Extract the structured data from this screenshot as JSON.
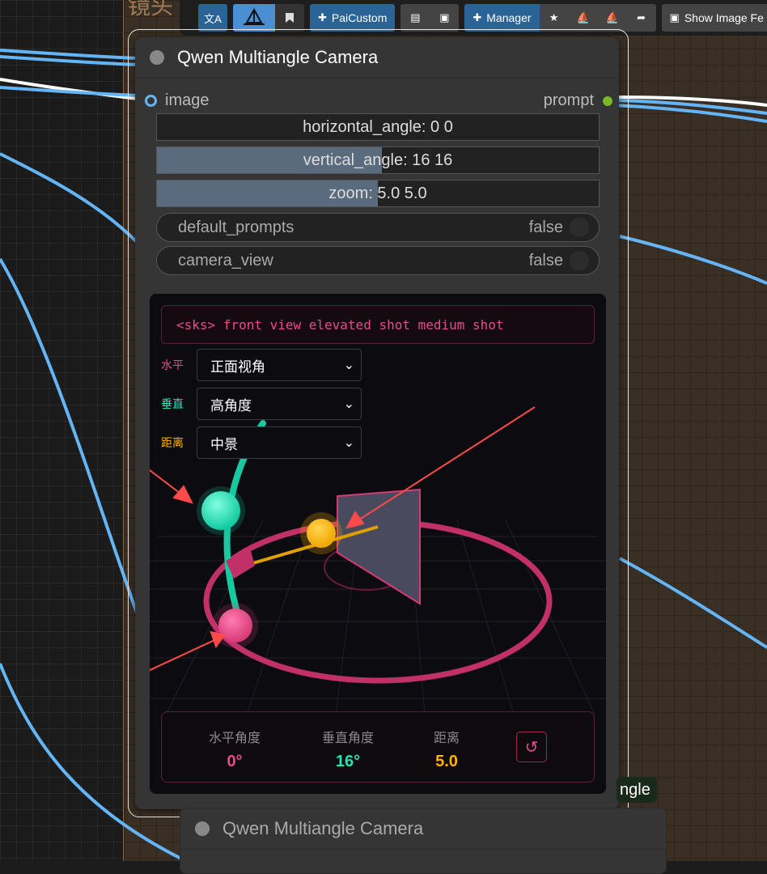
{
  "group": {
    "title": "镜头"
  },
  "toolbar": {
    "translate_icon": "translate-icon",
    "bookmark_icon": "bookmark-icon",
    "paicustom_label": "PaiCustom",
    "manager_label": "Manager",
    "show_image_label": "Show Image Fe"
  },
  "node": {
    "title": "Qwen Multiangle Camera",
    "input_label": "image",
    "output_label": "prompt",
    "horizontal_angle": {
      "label": "horizontal_angle: 0  0",
      "fraction": 0
    },
    "vertical_angle": {
      "label": "vertical_angle: 16  16",
      "fraction": 0.51
    },
    "zoom": {
      "label": "zoom: 5.0  5.0",
      "fraction": 0.5
    },
    "default_prompts": {
      "label": "default_prompts",
      "value": "false"
    },
    "camera_view": {
      "label": "camera_view",
      "value": "false"
    }
  },
  "camera": {
    "prompt_text": "<sks> front view elevated shot medium shot",
    "horizontal": {
      "label": "水平",
      "value": "正面视角",
      "color": "#e74c8c"
    },
    "vertical": {
      "label": "垂直",
      "value": "高角度",
      "color": "#1de9b6"
    },
    "distance": {
      "label": "距离",
      "value": "中景",
      "color": "#ffb300"
    },
    "stats": {
      "h_label": "水平角度",
      "h_value": "0°",
      "v_label": "垂直角度",
      "v_value": "16°",
      "d_label": "距离",
      "d_value": "5.0"
    },
    "reset_icon": "reset-icon"
  },
  "badge": {
    "text": "ngle"
  },
  "node2": {
    "title": "Qwen Multiangle Camera"
  }
}
